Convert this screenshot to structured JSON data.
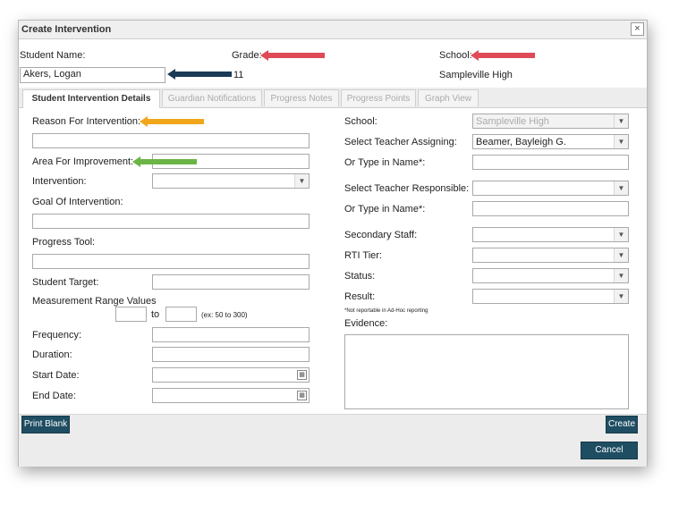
{
  "dialog": {
    "title": "Create Intervention",
    "close": "×"
  },
  "header": {
    "student_name_label": "Student Name:",
    "grade_label": "Grade:",
    "school_label": "School:",
    "student_name_value": "Akers, Logan",
    "grade_value": "11",
    "school_value": "Sampleville High"
  },
  "tabs": [
    {
      "label": "Student Intervention Details"
    },
    {
      "label": "Guardian Notifications"
    },
    {
      "label": "Progress Notes"
    },
    {
      "label": "Progress Points"
    },
    {
      "label": "Graph View"
    }
  ],
  "left": {
    "reason_label": "Reason For Intervention:",
    "area_label": "Area For Improvement:",
    "intervention_label": "Intervention:",
    "goal_label": "Goal Of Intervention:",
    "progress_tool_label": "Progress Tool:",
    "student_target_label": "Student Target:",
    "measurement_label": "Measurement Range Values",
    "to_label": "to",
    "range_hint": "(ex: 50 to 300)",
    "frequency_label": "Frequency:",
    "duration_label": "Duration:",
    "start_date_label": "Start Date:",
    "end_date_label": "End Date:"
  },
  "right": {
    "school_label": "School:",
    "school_value": "Sampleville High",
    "teacher_assigning_label": "Select Teacher Assigning:",
    "teacher_assigning_value": "Beamer, Bayleigh G.",
    "type_in_name_label": "Or Type in Name*:",
    "teacher_responsible_label": "Select Teacher Responsible:",
    "type_in_name_label2": "Or Type in Name*:",
    "secondary_staff_label": "Secondary Staff:",
    "rti_tier_label": "RTI Tier:",
    "status_label": "Status:",
    "result_label": "Result:",
    "footnote": "*Not reportable in Ad-Hoc reporting",
    "evidence_label": "Evidence:"
  },
  "buttons": {
    "print_blank": "Print Blank",
    "create": "Create",
    "cancel": "Cancel"
  },
  "icons": {
    "dropdown": "▼",
    "calendar": "▦"
  },
  "colors": {
    "arrow_red": "#e04a57",
    "arrow_navy": "#1b3a55",
    "arrow_orange": "#f1a71b",
    "arrow_green": "#6bb446",
    "button": "#1f4e63"
  }
}
